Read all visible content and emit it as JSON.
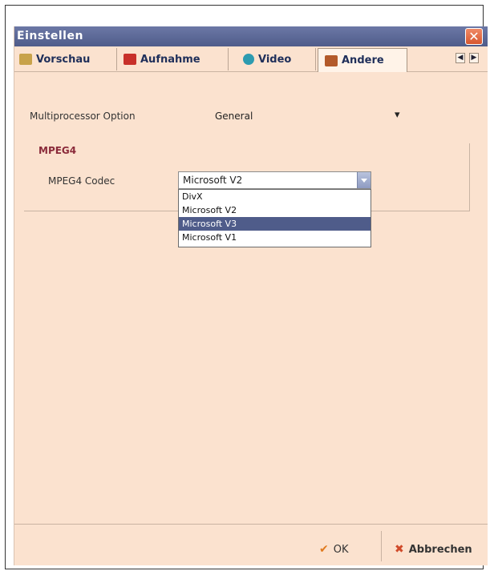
{
  "window": {
    "title": "Einstellen",
    "close": "✕"
  },
  "tabs": [
    {
      "label": "Vorschau",
      "icon": "preview-icon",
      "color": "#c8a24a"
    },
    {
      "label": "Aufnahme",
      "icon": "film-icon",
      "color": "#c8302a"
    },
    {
      "label": "Video",
      "icon": "video-icon",
      "color": "#2d9bb0"
    },
    {
      "label": "Andere",
      "icon": "settings-icon",
      "color": "#b35a2a"
    }
  ],
  "tab_scroll": {
    "left": "◀",
    "right": "▶"
  },
  "multiprocessor": {
    "label": "Multiprocessor Option",
    "value": "General",
    "arrow": "▾"
  },
  "mpeg4": {
    "group_title": "MPEG4",
    "codec_label": "MPEG4 Codec",
    "codec_value": "Microsoft V2",
    "options": [
      "DivX",
      "Microsoft V2",
      "Microsoft V3",
      "Microsoft V1"
    ],
    "selected_index": 2
  },
  "footer": {
    "ok": "OK",
    "ok_icon": "✔",
    "cancel": "Abbrechen",
    "cancel_icon": "✖"
  },
  "colors": {
    "accent": "#4f5c8a",
    "background": "#fbe2cf",
    "ok_check": "#e07a1f",
    "cancel_x": "#d04a2a"
  }
}
